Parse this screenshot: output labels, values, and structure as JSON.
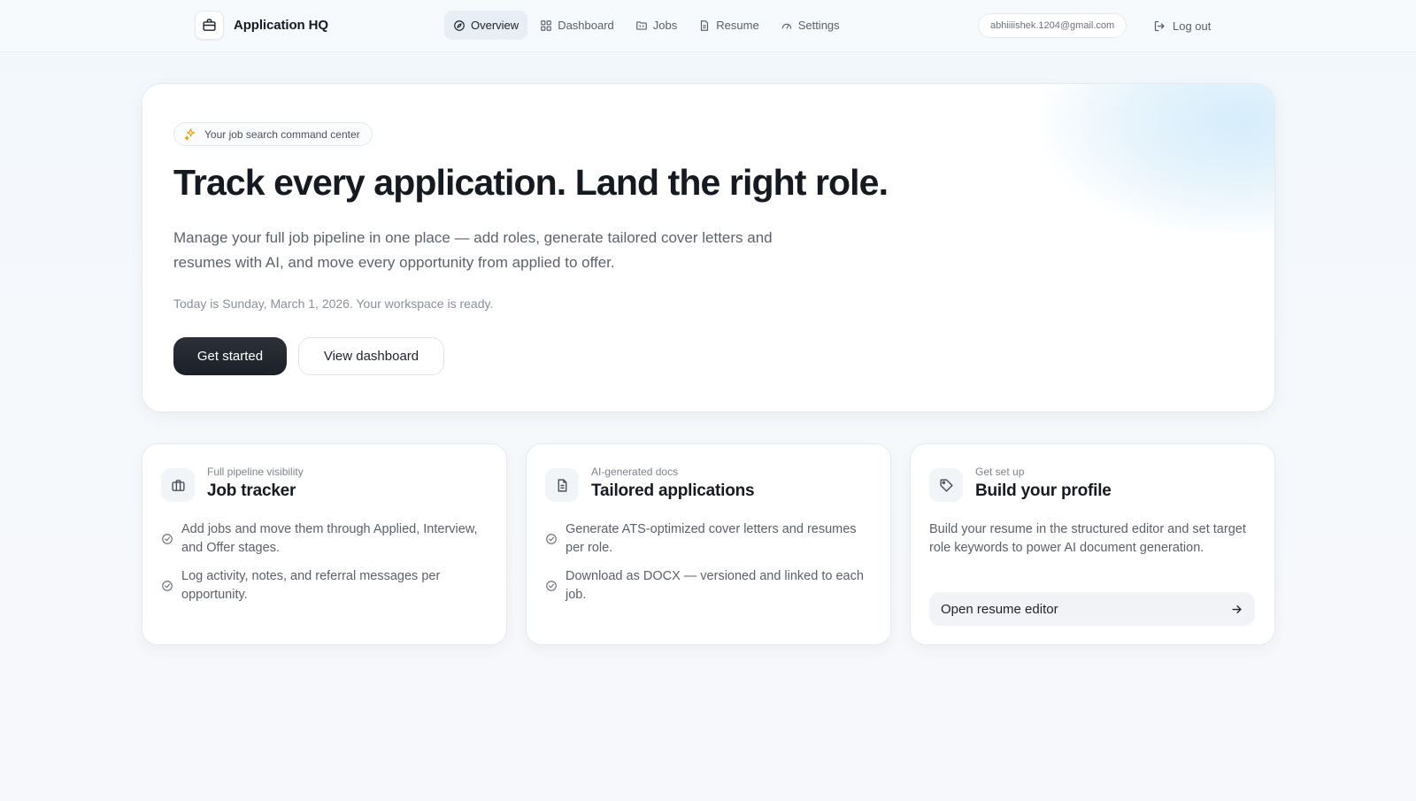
{
  "app": {
    "name": "Application HQ",
    "icon": "briefcase-icon"
  },
  "nav": {
    "items": [
      {
        "label": "Overview",
        "icon": "compass-icon",
        "active": true
      },
      {
        "label": "Dashboard",
        "icon": "grid-icon",
        "active": false
      },
      {
        "label": "Jobs",
        "icon": "folder-icon",
        "active": false
      },
      {
        "label": "Resume",
        "icon": "document-icon",
        "active": false
      },
      {
        "label": "Settings",
        "icon": "gauge-icon",
        "active": false
      }
    ]
  },
  "user": {
    "email": "abhiiiishek.1204@gmail.com",
    "logout_label": "Log out"
  },
  "hero": {
    "chip": "Your job search command center",
    "title": "Track every application. Land the right role.",
    "description": "Manage your full job pipeline in one place — add roles, generate tailored cover letters and resumes with AI, and move every opportunity from applied to offer.",
    "date_line": "Today is Sunday, March 1, 2026. Your workspace is ready.",
    "primary_button": "Get started",
    "secondary_button": "View dashboard"
  },
  "cards": [
    {
      "eyebrow": "Full pipeline visibility",
      "title": "Job tracker",
      "icon": "briefcase-icon",
      "items": [
        "Add jobs and move them through Applied, Interview, and Offer stages.",
        "Log activity, notes, and referral messages per opportunity."
      ]
    },
    {
      "eyebrow": "AI-generated docs",
      "title": "Tailored applications",
      "icon": "document-icon",
      "items": [
        "Generate ATS-optimized cover letters and resumes per role.",
        "Download as DOCX — versioned and linked to each job."
      ]
    },
    {
      "eyebrow": "Get set up",
      "title": "Build your profile",
      "icon": "tag-icon",
      "text": "Build your resume in the structured editor and set target role keywords to power AI document generation.",
      "cta": "Open resume editor"
    }
  ],
  "colors": {
    "primary": "#1f232b",
    "accent_chip": "#e8a21a",
    "background": "#f3f8fc"
  }
}
